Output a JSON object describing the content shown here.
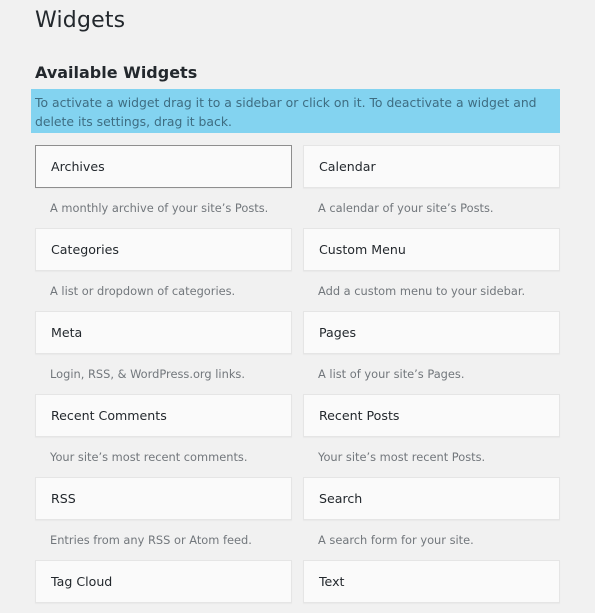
{
  "page": {
    "title": "Widgets",
    "section_title": "Available Widgets",
    "description": "To activate a widget drag it to a sidebar or click on it. To deactivate a widget and delete its settings, drag it back."
  },
  "colors": {
    "description_highlight": "#83d3f0",
    "background": "#f1f1f1"
  },
  "widgets": [
    {
      "title": "Archives",
      "description": "A monthly archive of your site’s Posts.",
      "selected": true
    },
    {
      "title": "Calendar",
      "description": "A calendar of your site’s Posts."
    },
    {
      "title": "Categories",
      "description": "A list or dropdown of categories."
    },
    {
      "title": "Custom Menu",
      "description": "Add a custom menu to your sidebar."
    },
    {
      "title": "Meta",
      "description": "Login, RSS, & WordPress.org links."
    },
    {
      "title": "Pages",
      "description": "A list of your site’s Pages."
    },
    {
      "title": "Recent Comments",
      "description": "Your site’s most recent comments."
    },
    {
      "title": "Recent Posts",
      "description": "Your site’s most recent Posts."
    },
    {
      "title": "RSS",
      "description": "Entries from any RSS or Atom feed."
    },
    {
      "title": "Search",
      "description": "A search form for your site."
    },
    {
      "title": "Tag Cloud",
      "description": ""
    },
    {
      "title": "Text",
      "description": ""
    }
  ]
}
